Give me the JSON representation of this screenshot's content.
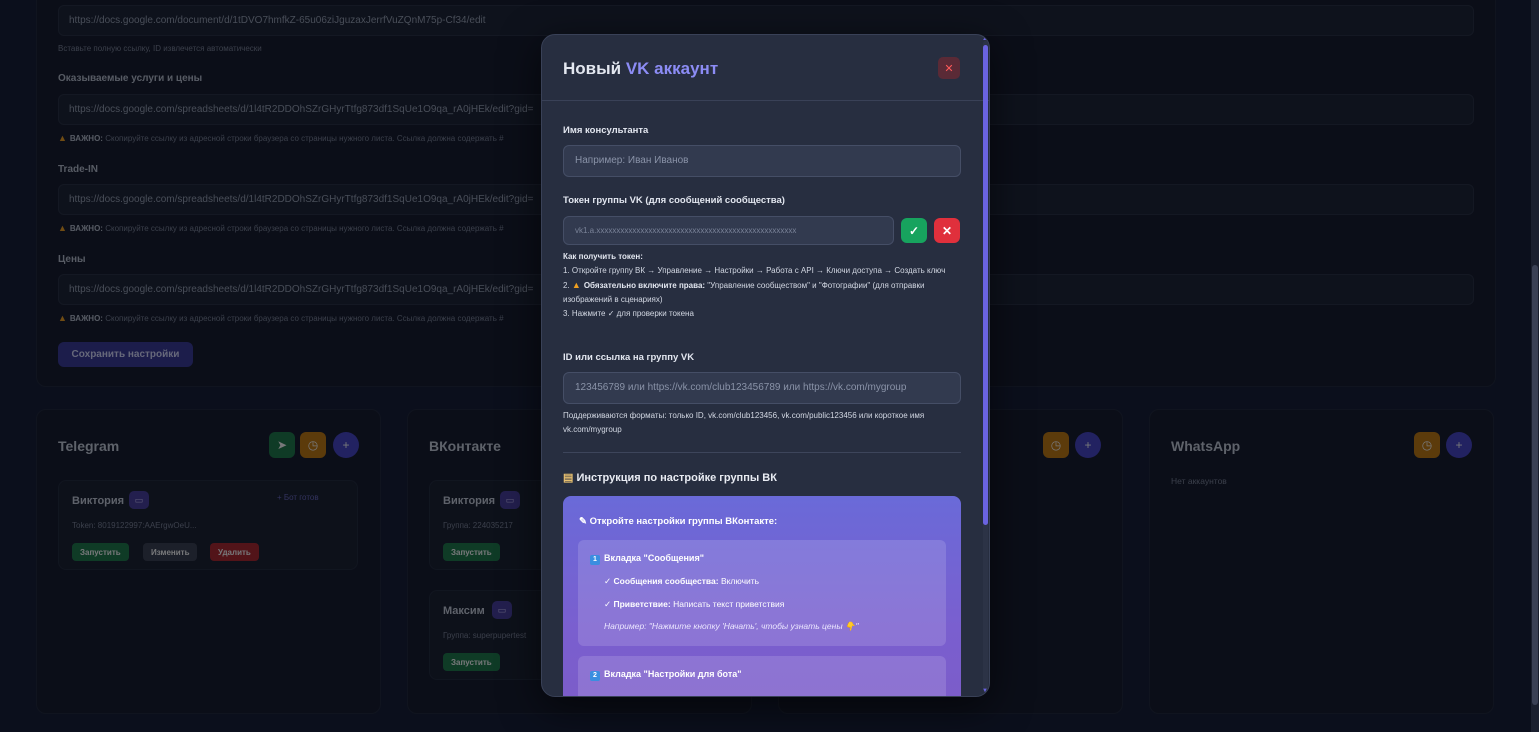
{
  "settings": {
    "doc_url": "https://docs.google.com/document/d/1tDVO7hmfkZ-65u06ziJguzaxJerrfVuZQnM75p-Cf34/edit",
    "doc_hint": "Вставьте полную ссылку, ID извлечется автоматически",
    "services_label": "Оказываемые услуги и цены",
    "services_url": "https://docs.google.com/spreadsheets/d/1l4tR2DDOhSZrGHyrTtfg873df1SqUe1O9qa_rA0jHEk/edit?gid=",
    "warn_bold": "ВАЖНО:",
    "warn_text": "Скопируйте ссылку из адресной строки браузера со страницы нужного листа. Ссылка должна содержать #",
    "tradein_label": "Trade-IN",
    "tradein_url": "https://docs.google.com/spreadsheets/d/1l4tR2DDOhSZrGHyrTtfg873df1SqUe1O9qa_rA0jHEk/edit?gid=",
    "prices_label": "Цены",
    "prices_url": "https://docs.google.com/spreadsheets/d/1l4tR2DDOhSZrGHyrTtfg873df1SqUe1O9qa_rA0jHEk/edit?gid=",
    "save_label": "Сохранить настройки"
  },
  "telegram": {
    "title": "Telegram",
    "account_name": "Виктория",
    "badge": "+ Бот готов",
    "token": "Token: 8019122997:AAErgwOeU...",
    "start": "Запустить",
    "edit": "Изменить",
    "delete": "Удалить"
  },
  "vk": {
    "title": "ВКонтакте",
    "acc1_name": "Виктория",
    "acc1_group": "Группа: 224035217",
    "acc2_name": "Максим",
    "acc2_group": "Группа: superpupertest",
    "start": "Запустить"
  },
  "whatsapp": {
    "title": "WhatsApp",
    "empty": "Нет аккаунтов"
  },
  "modal": {
    "title_main": "Новый",
    "title_accent": "VK аккаунт",
    "close_glyph": "✕",
    "consultant_label": "Имя консультанта",
    "consultant_placeholder": "Например: Иван Иванов",
    "token_label": "Токен группы VK (для сообщений сообщества)",
    "token_placeholder": "vk1.a.xxxxxxxxxxxxxxxxxxxxxxxxxxxxxxxxxxxxxxxxxxxxxxxxxx",
    "check_glyph": "✓",
    "clear_glyph": "✕",
    "how_title": "Как получить токен:",
    "how_1": "1. Откройте группу ВК → Управление → Настройки → Работа с API → Ключи доступа → Создать ключ",
    "how_2_prefix": "2.",
    "how_2_bold": "Обязательно включите права:",
    "how_2_text": "\"Управление сообществом\" и \"Фотографии\" (для отправки изображений в сценариях)",
    "how_3": "3. Нажмите ✓ для проверки токена",
    "group_label": "ID или ссылка на группу VK",
    "group_placeholder": "123456789 или https://vk.com/club123456789 или https://vk.com/mygroup",
    "group_hint": "Поддерживаются форматы: только ID, vk.com/club123456, vk.com/public123456 или короткое имя vk.com/mygroup",
    "instr_title": "Инструкция по настройке группы ВК",
    "instr_head": "Откройте настройки группы ВКонтакте:",
    "tab1_num": "1",
    "tab1_title": "Вкладка \"Сообщения\"",
    "tab1_l1_bold": "Сообщения сообщества:",
    "tab1_l1_text": "Включить",
    "tab1_l2_bold": "Приветствие:",
    "tab1_l2_text": "Написать текст приветствия",
    "tab1_example": "Например: \"Нажмите кнопку 'Начать', чтобы узнать цены 👇\"",
    "tab2_num": "2",
    "tab2_title": "Вкладка \"Настройки для бота\""
  }
}
